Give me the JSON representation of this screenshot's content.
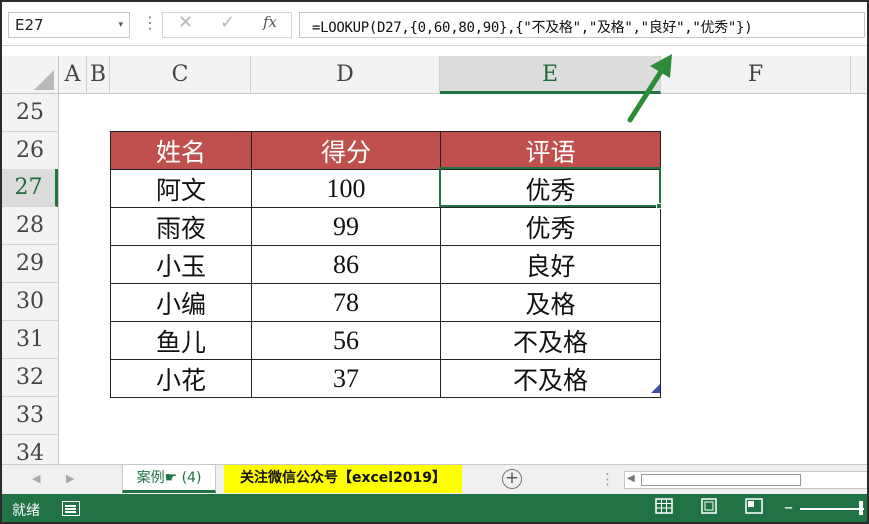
{
  "formula_bar": {
    "name_box": "E27",
    "name_box_arrow": "▾",
    "dots_icon": "⋮",
    "cancel_icon": "✕",
    "enter_icon": "✓",
    "fx_label": "fx",
    "formula": "=LOOKUP(D27,{0,60,80,90},{\"不及格\",\"及格\",\"良好\",\"优秀\"})"
  },
  "columns": [
    "A",
    "B",
    "C",
    "D",
    "E",
    "F"
  ],
  "active_column": "E",
  "rows": [
    "25",
    "26",
    "27",
    "28",
    "29",
    "30",
    "31",
    "32",
    "33",
    "34"
  ],
  "active_row": "27",
  "table": {
    "headers": [
      "姓名",
      "得分",
      "评语"
    ],
    "rows": [
      [
        "阿文",
        "100",
        "优秀"
      ],
      [
        "雨夜",
        "99",
        "优秀"
      ],
      [
        "小玉",
        "86",
        "良好"
      ],
      [
        "小编",
        "78",
        "及格"
      ],
      [
        "鱼儿",
        "56",
        "不及格"
      ],
      [
        "小花",
        "37",
        "不及格"
      ]
    ],
    "header_color": "#c0504d"
  },
  "sheet_tabs": {
    "active": "案例☛ (4)",
    "second": "关注微信公众号【excel2019】",
    "second_color": "#ffff00",
    "add_icon": "+",
    "separator": "⋮"
  },
  "status_bar": {
    "ready": "就绪",
    "accent": "#217346",
    "zoom_minus": "–"
  }
}
